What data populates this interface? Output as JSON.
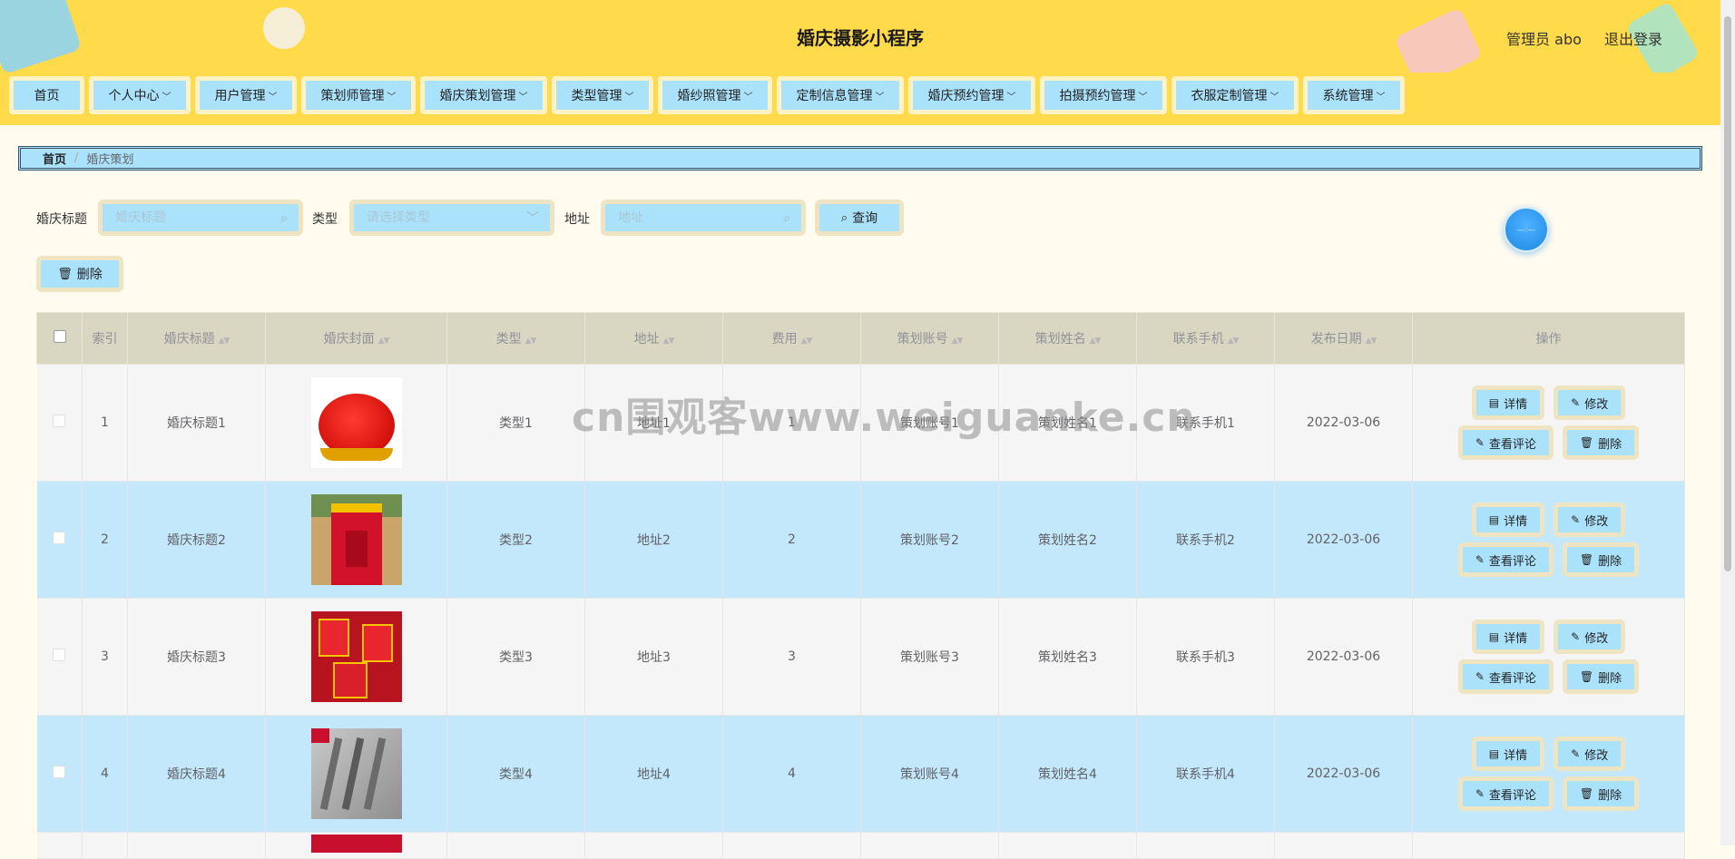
{
  "header": {
    "title": "婚庆摄影小程序",
    "user": "管理员 abo",
    "logout": "退出登录"
  },
  "nav": [
    {
      "label": "首页",
      "has_menu": false
    },
    {
      "label": "个人中心",
      "has_menu": true
    },
    {
      "label": "用户管理",
      "has_menu": true
    },
    {
      "label": "策划师管理",
      "has_menu": true
    },
    {
      "label": "婚庆策划管理",
      "has_menu": true
    },
    {
      "label": "类型管理",
      "has_menu": true
    },
    {
      "label": "婚纱照管理",
      "has_menu": true
    },
    {
      "label": "定制信息管理",
      "has_menu": true
    },
    {
      "label": "婚庆预约管理",
      "has_menu": true
    },
    {
      "label": "拍摄预约管理",
      "has_menu": true
    },
    {
      "label": "衣服定制管理",
      "has_menu": true
    },
    {
      "label": "系统管理",
      "has_menu": true
    }
  ],
  "breadcrumb": {
    "home": "首页",
    "separator": "/",
    "current": "婚庆策划"
  },
  "search": {
    "title_label": "婚庆标题",
    "title_placeholder": "婚庆标题",
    "title_value": "",
    "type_label": "类型",
    "type_placeholder": "请选择类型",
    "type_value": "",
    "address_label": "地址",
    "address_placeholder": "地址",
    "address_value": "",
    "query_button": "查询"
  },
  "toolbar": {
    "delete_button": "删除"
  },
  "table": {
    "columns": [
      "索引",
      "婚庆标题",
      "婚庆封面",
      "类型",
      "地址",
      "费用",
      "策划账号",
      "策划姓名",
      "联系手机",
      "发布日期",
      "操作"
    ],
    "rows": [
      {
        "index": "1",
        "title": "婚庆标题1",
        "type": "类型1",
        "address": "地址1",
        "fee": "1",
        "account": "策划账号1",
        "name": "策划姓名1",
        "phone": "联系手机1",
        "date": "2022-03-06"
      },
      {
        "index": "2",
        "title": "婚庆标题2",
        "type": "类型2",
        "address": "地址2",
        "fee": "2",
        "account": "策划账号2",
        "name": "策划姓名2",
        "phone": "联系手机2",
        "date": "2022-03-06"
      },
      {
        "index": "3",
        "title": "婚庆标题3",
        "type": "类型3",
        "address": "地址3",
        "fee": "3",
        "account": "策划账号3",
        "name": "策划姓名3",
        "phone": "联系手机3",
        "date": "2022-03-06"
      },
      {
        "index": "4",
        "title": "婚庆标题4",
        "type": "类型4",
        "address": "地址4",
        "fee": "4",
        "account": "策划账号4",
        "name": "策划姓名4",
        "phone": "联系手机4",
        "date": "2022-03-06"
      }
    ],
    "actions": {
      "detail": "详情",
      "edit": "修改",
      "comments": "查看评论",
      "delete": "删除"
    }
  },
  "watermark": "cn围观客www.weiguanke.cn",
  "colors": {
    "header_bg": "#ffda4a",
    "button_bg": "#abe2fb",
    "button_border": "#efe4c2",
    "page_bg": "#fffcef",
    "row_alt": "#c3e7fb",
    "table_head": "#d9d6c1"
  }
}
